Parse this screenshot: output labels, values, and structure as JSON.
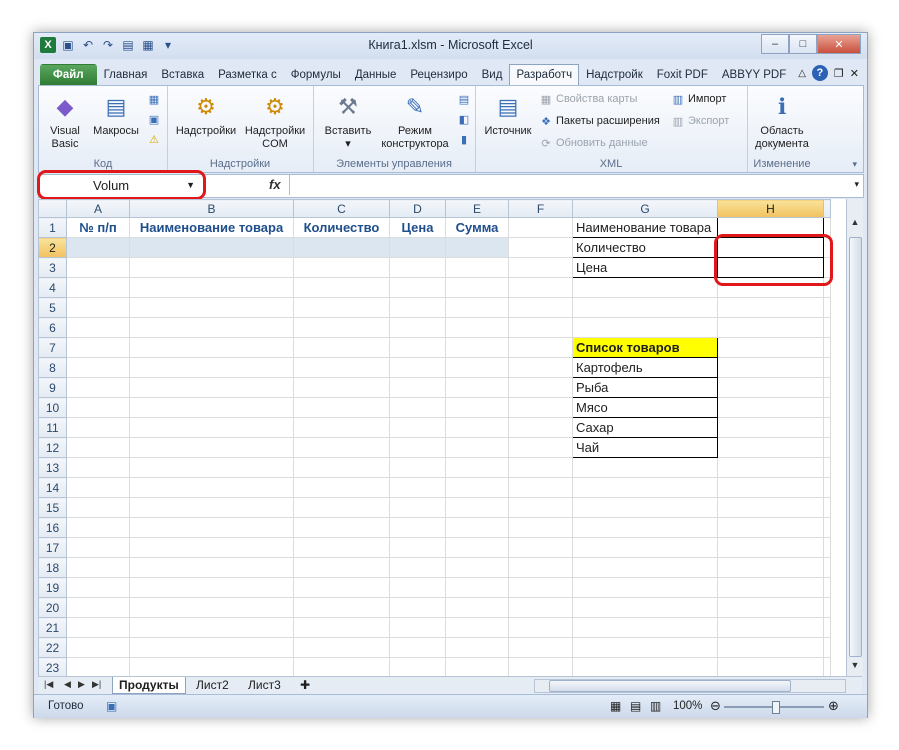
{
  "window": {
    "title": "Книга1.xlsm  -  Microsoft Excel",
    "buttons": {
      "minimize": "‒",
      "maximize": "□",
      "close": "✕"
    }
  },
  "ribbon_tabs": [
    "Файл",
    "Главная",
    "Вставка",
    "Разметка с",
    "Формулы",
    "Данные",
    "Рецензиро",
    "Вид",
    "Разработч",
    "Надстройк",
    "Foxit PDF",
    "ABBYY PDF"
  ],
  "active_tab": "Разработч",
  "ribbon": {
    "code": {
      "caption": "Код",
      "visual_basic": "Visual\nBasic",
      "macros": "Макросы"
    },
    "addins": {
      "caption": "Надстройки",
      "addins": "Надстройки",
      "com_addins": "Надстройки\nCOM"
    },
    "controls": {
      "caption": "Элементы управления",
      "insert": "Вставить\n▾",
      "design_mode": "Режим\nконструктора"
    },
    "xml": {
      "caption": "XML",
      "source": "Источник",
      "map_properties": "Свойства карты",
      "expansion_packs": "Пакеты расширения",
      "refresh_data": "Обновить данные",
      "import": "Импорт",
      "export": "Экспорт"
    },
    "modify": {
      "caption": "Изменение",
      "document_panel": "Область\nдокумента"
    }
  },
  "formula_bar": {
    "name_box": "Volum",
    "fx": "fx",
    "formula": ""
  },
  "columns": [
    "A",
    "B",
    "C",
    "D",
    "E",
    "F",
    "G",
    "H"
  ],
  "selected_column": "H",
  "selected_row": "2",
  "rows": [
    "1",
    "2",
    "3",
    "4",
    "5",
    "6",
    "7",
    "8",
    "9",
    "10",
    "11",
    "12",
    "13",
    "14",
    "15",
    "16",
    "17",
    "18",
    "19",
    "20",
    "21",
    "22",
    "23"
  ],
  "table_headers": [
    "№ п/п",
    "Наименование товара",
    "Количество",
    "Цена",
    "Сумма"
  ],
  "side_labels": [
    "Наименование товара",
    "Количество",
    "Цена"
  ],
  "list": {
    "title": "Список товаров",
    "items": [
      "Картофель",
      "Рыба",
      "Мясо",
      "Сахар",
      "Чай"
    ]
  },
  "sheets": [
    "Продукты",
    "Лист2",
    "Лист3"
  ],
  "active_sheet": "Продукты",
  "status": {
    "ready": "Готово",
    "zoom": "100%"
  },
  "colors": {
    "highlight": "#e0181a",
    "list_header": "#ffff00",
    "file_tab": "#2f7d34"
  }
}
